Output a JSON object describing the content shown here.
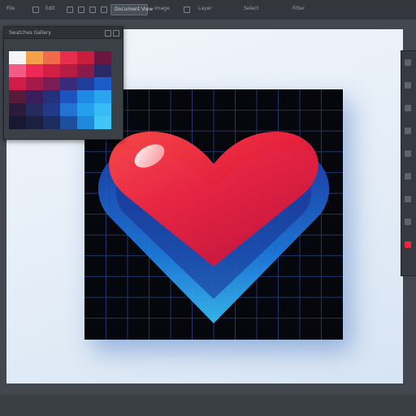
{
  "menubar": {
    "items": [
      "File",
      "Edit",
      "Image",
      "Layer",
      "Select",
      "Filter"
    ],
    "active_button": "Document View"
  },
  "swatches_panel": {
    "title": "Swatches Gallery",
    "colors": [
      "#f5f5f7",
      "#f4a14a",
      "#f16a4a",
      "#e72e4d",
      "#c81d3e",
      "#6a1640",
      "#f35a86",
      "#ec2a55",
      "#d21f47",
      "#b41c44",
      "#8a1a4c",
      "#2a2966",
      "#d11c49",
      "#a51a4a",
      "#7a1c55",
      "#3a2a7a",
      "#1f3d9a",
      "#1a5cc8",
      "#5a1a3a",
      "#3a1d5a",
      "#25307a",
      "#1e52bf",
      "#1f8ae6",
      "#2aa5f2",
      "#2c1a3a",
      "#262a5c",
      "#22388a",
      "#2374d2",
      "#22a0ee",
      "#36bdf6",
      "#1a1830",
      "#1c2040",
      "#1c2c60",
      "#1e4f9c",
      "#1f88dc",
      "#40c6f6"
    ]
  },
  "theme": {
    "canvas_bg": "#05070c",
    "grid_line": "#243b78",
    "heart_red": "#f0243f",
    "heart_blue": "#1f7fe8"
  },
  "icons": {
    "topbar": [
      "folder-icon",
      "save-icon",
      "undo-icon",
      "redo-icon",
      "grid-icon",
      "tool-icon"
    ],
    "right_panel": [
      "move-icon",
      "brush-icon",
      "eraser-icon",
      "pen-icon",
      "text-icon",
      "shape-icon",
      "zoom-icon",
      "layers-icon",
      "color-icon"
    ]
  }
}
